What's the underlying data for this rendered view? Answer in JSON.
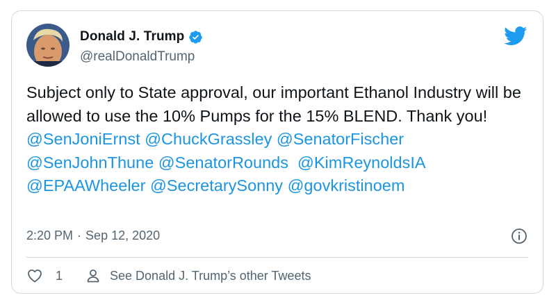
{
  "author": {
    "display_name": "Donald J. Trump",
    "handle": "@realDonaldTrump",
    "verified": true
  },
  "tweet": {
    "text_part1": "Subject only to State approval, our important Ethanol Industry will be allowed to use the 10% Pumps for the 15% BLEND. Thank you!",
    "mentions": [
      "@SenJoniErnst",
      "@ChuckGrassley",
      "@SenatorFischer",
      "@SenJohnThune",
      "@SenatorRounds",
      "@KimReynoldsIA",
      "@EPAAWheeler",
      "@SecretarySonny",
      "@govkristinoem"
    ]
  },
  "meta": {
    "time": "2:20 PM",
    "separator": "·",
    "date": "Sep 12, 2020"
  },
  "actions": {
    "like_count": "1",
    "profile_link_label": "See Donald J. Trump’s other Tweets"
  },
  "colors": {
    "link": "#1b95e0",
    "twitter_blue": "#1d9bf0",
    "secondary_text": "#536471",
    "border": "#cfd9de"
  },
  "icons": {
    "brand": "twitter-bird-icon",
    "verified": "verified-badge-icon",
    "info": "info-icon",
    "like": "heart-icon",
    "profile": "person-icon"
  }
}
